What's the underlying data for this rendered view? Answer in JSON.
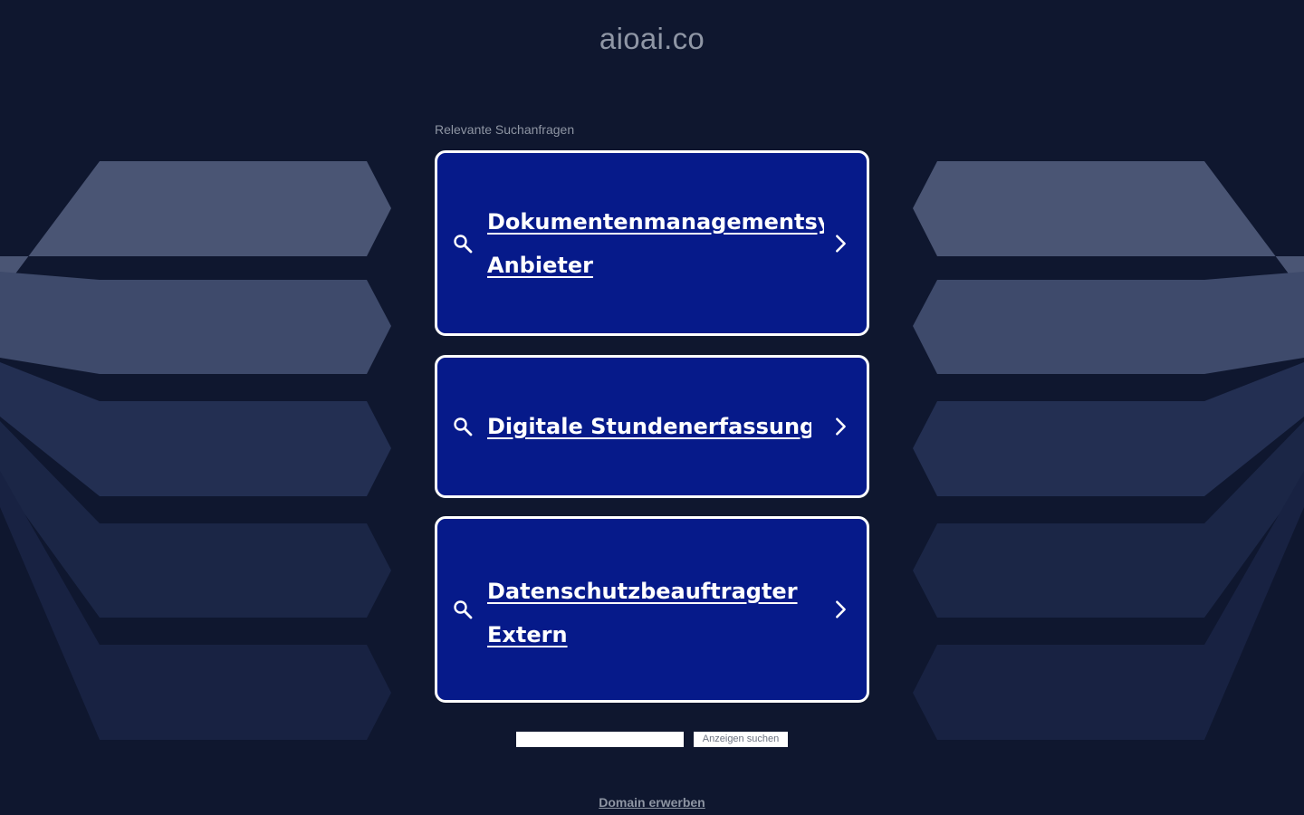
{
  "header": {
    "domain": "aioai.co"
  },
  "related": {
    "label": "Relevante Suchanfragen",
    "items": [
      {
        "lines": [
          "Dokumentenmanagementsystem",
          "Anbieter"
        ]
      },
      {
        "lines": [
          "Digitale Stundenerfassung"
        ]
      },
      {
        "lines": [
          "Datenschutzbeauftragter",
          "Extern"
        ]
      }
    ]
  },
  "search": {
    "input_value": "",
    "button_label": "Anzeigen suchen"
  },
  "footer": {
    "buy_domain_label": "Domain erwerben"
  },
  "icons": {
    "card_left": "search-icon",
    "card_right": "chevron-right-icon"
  },
  "colors": {
    "background": "#0f172f",
    "card": "#061a8a",
    "card_border": "#ffffff",
    "muted_text": "#8e95a3"
  }
}
